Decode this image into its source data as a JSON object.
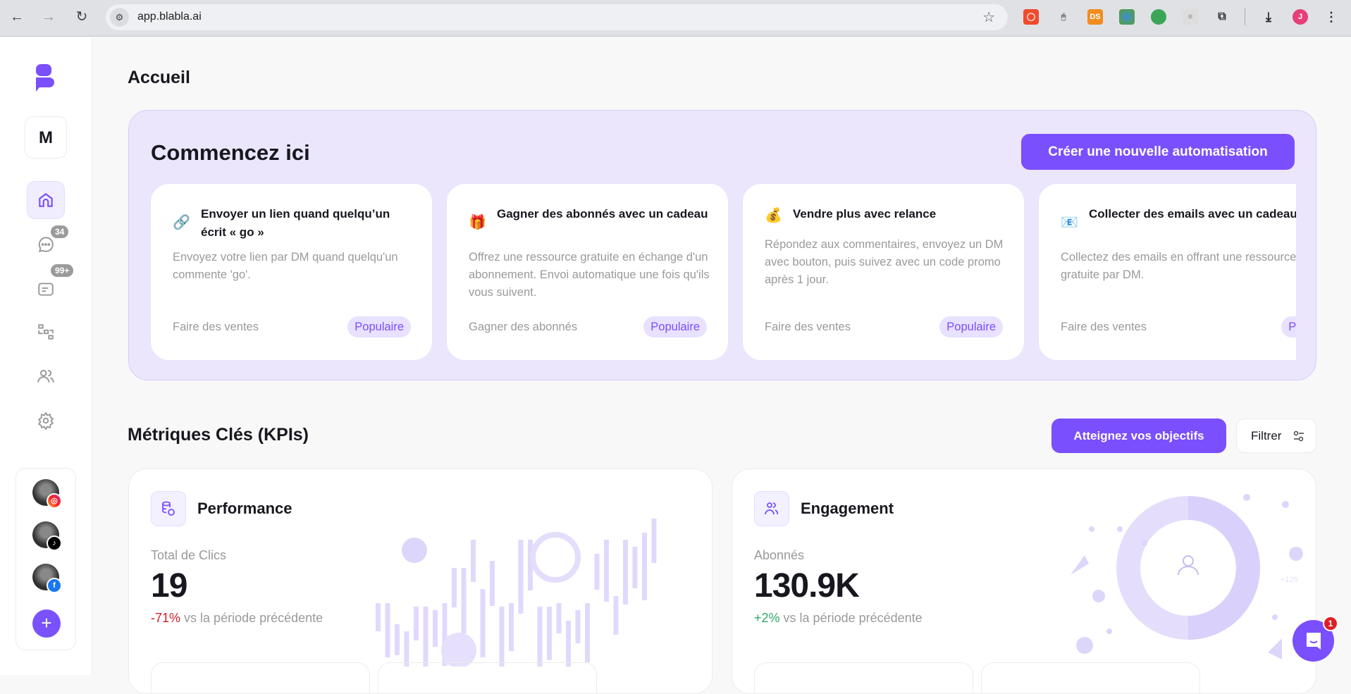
{
  "browser": {
    "url": "app.blabla.ai",
    "profile_initial": "J",
    "ext_ds": "DS"
  },
  "sidebar": {
    "workspace_initial": "M",
    "badges": {
      "messages": "34",
      "comments": "99+"
    },
    "add_label": "+"
  },
  "page": {
    "title": "Accueil"
  },
  "hero": {
    "title": "Commencez ici",
    "cta": "Créer une nouvelle automatisation",
    "cards": [
      {
        "icon": "link-icon",
        "emoji": "🔗",
        "title": "Envoyer un lien quand quelqu’un écrit « go »",
        "desc": "Envoyez votre lien par DM quand quelqu'un commente 'go'.",
        "category": "Faire des ventes",
        "tag": "Populaire"
      },
      {
        "icon": "gift-icon",
        "emoji": "🎁",
        "title": "Gagner des abonnés avec un cadeau",
        "desc": "Offrez une ressource gratuite en échange d'un abonnement. Envoi automatique une fois qu'ils vous suivent.",
        "category": "Gagner des abonnés",
        "tag": "Populaire"
      },
      {
        "icon": "money-bag-icon",
        "emoji": "💰",
        "title": "Vendre plus avec relance",
        "desc": "Répondez aux commentaires, envoyez un DM avec bouton, puis suivez avec un code promo après 1 jour.",
        "category": "Faire des ventes",
        "tag": "Populaire"
      },
      {
        "icon": "email-icon",
        "emoji": "📧",
        "title": "Collecter des emails avec un cadeau",
        "desc": "Collectez des emails en offrant une ressource gratuite par DM.",
        "category": "Faire des ventes",
        "tag": "Populaire"
      }
    ]
  },
  "kpis": {
    "title": "Métriques Clés (KPIs)",
    "goals_button": "Atteignez vos objectifs",
    "filter_button": "Filtrer",
    "cards": [
      {
        "title": "Performance",
        "label": "Total de Clics",
        "value": "19",
        "delta": "-71%",
        "delta_color": "#d0202a",
        "compare": "vs la période précédente"
      },
      {
        "title": "Engagement",
        "label": "Abonnés",
        "value": "130.9K",
        "delta": "+2%",
        "delta_color": "#2fa86a",
        "compare": "vs la période précédente",
        "deco_text": "+125"
      }
    ]
  },
  "chat": {
    "unread": "1"
  },
  "colors": {
    "accent": "#7a4ffd",
    "hero_bg": "#ebe6fc",
    "pill_bg": "#e8e1ff"
  }
}
